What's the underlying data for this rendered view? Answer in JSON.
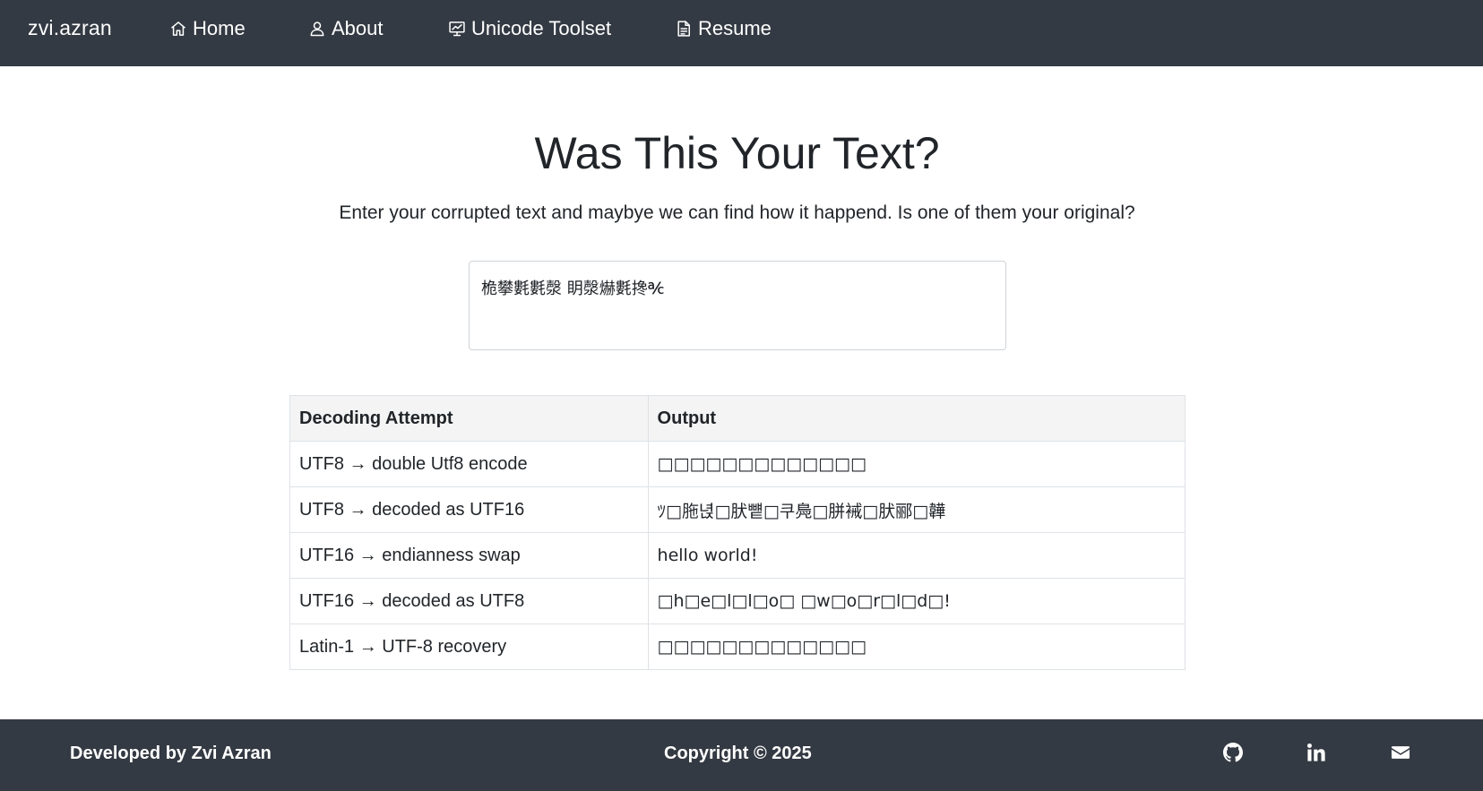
{
  "navbar": {
    "brand": "zvi.azran",
    "items": [
      {
        "label": "Home",
        "icon": "home-icon"
      },
      {
        "label": "About",
        "icon": "user-icon"
      },
      {
        "label": "Unicode Toolset",
        "icon": "presentation-chart-icon"
      },
      {
        "label": "Resume",
        "icon": "document-icon"
      }
    ]
  },
  "main": {
    "title": "Was This Your Text?",
    "subtitle": "Enter your corrupted text and maybye we can find how it happend. Is one of them your original?",
    "input_value": "桅攀氀氀漀 眀漀爀氀搀℀",
    "table": {
      "headers": [
        "Decoding Attempt",
        "Output"
      ],
      "rows": [
        {
          "attempt": "UTF8 → double Utf8 encode",
          "output": "□□□□□□□□□□□□□"
        },
        {
          "attempt": "UTF8 → decoded as UTF16",
          "output": "ﾂ□胣녅□肰뻍□쿠鳧□胼裓□肰郦□韡"
        },
        {
          "attempt": "UTF16 → endianness swap",
          "output": "hello world!"
        },
        {
          "attempt": "UTF16 → decoded as UTF8",
          "output": "□h□e□l□l□o□ □w□o□r□l□d□!"
        },
        {
          "attempt": "Latin-1 → UTF-8 recovery",
          "output": "□□□□□□□□□□□□□"
        }
      ]
    }
  },
  "footer": {
    "developer": "Developed by Zvi Azran",
    "copyright": "Copyright © 2025",
    "icons": [
      "github-icon",
      "linkedin-icon",
      "mail-icon"
    ]
  },
  "colors": {
    "nav_bg": "#343a43",
    "footer_bg": "#343a43",
    "table_header_bg": "#f4f4f4",
    "border": "#dee2e6"
  }
}
